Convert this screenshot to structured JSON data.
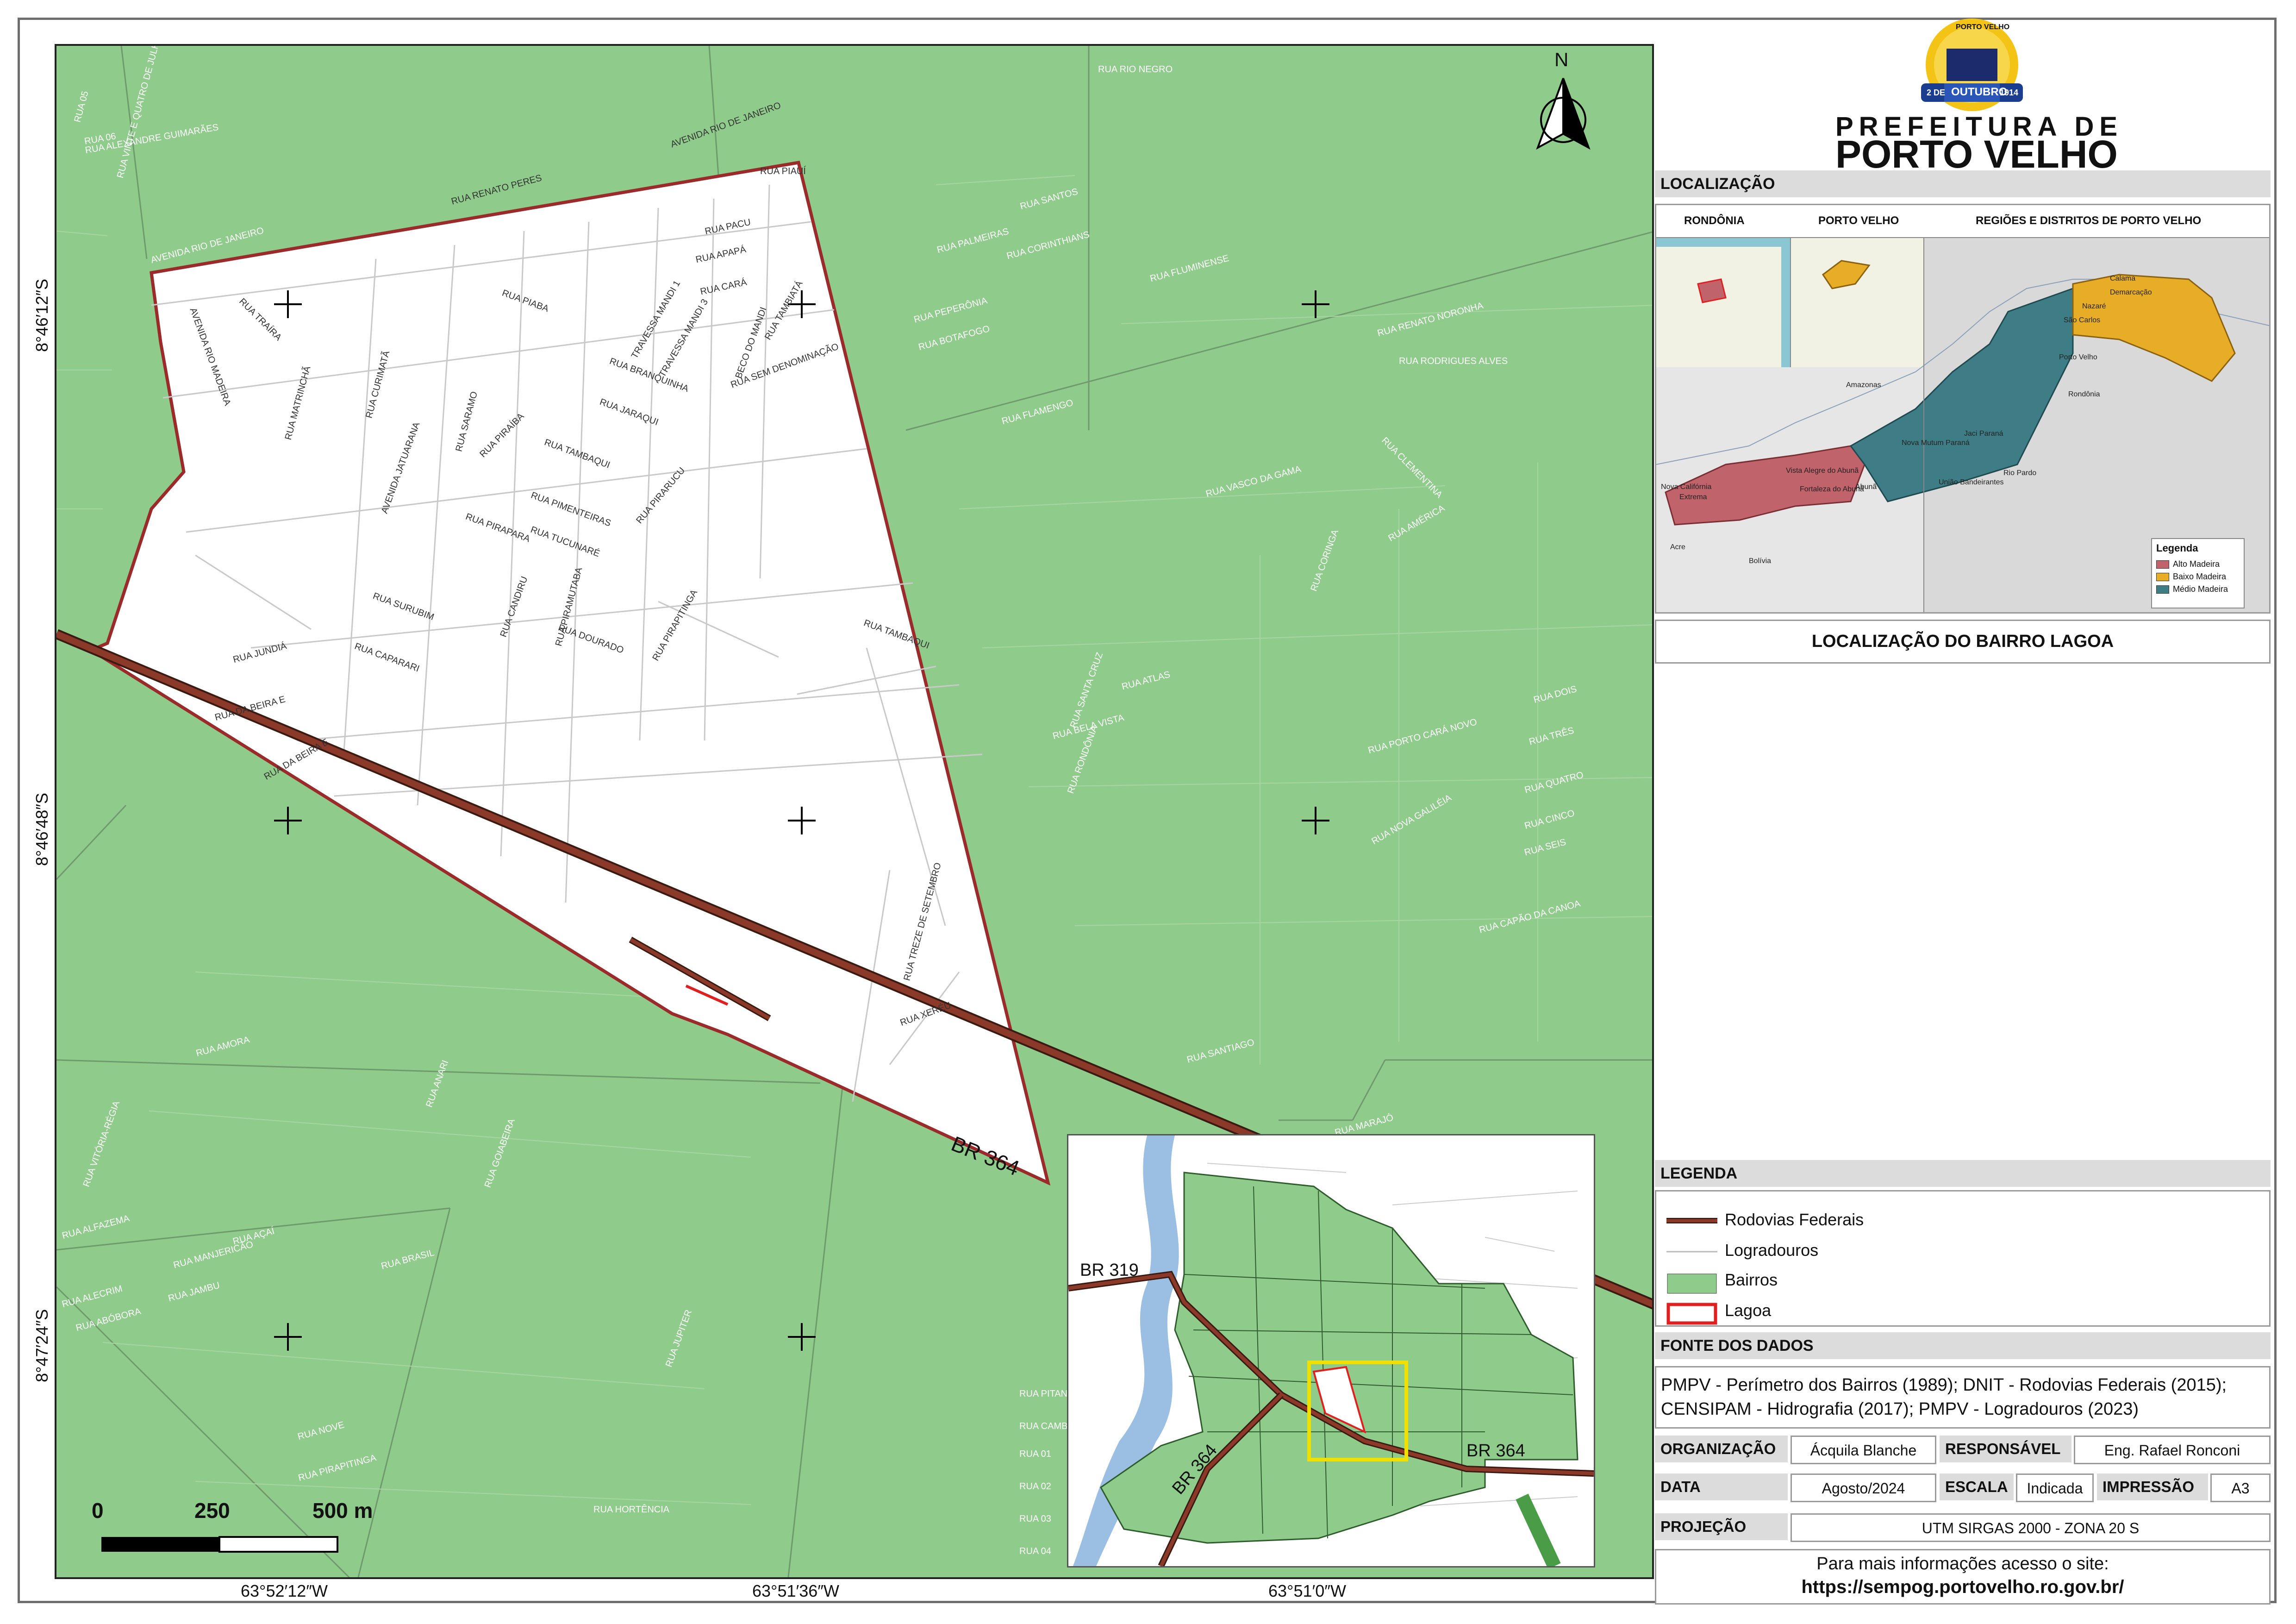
{
  "map": {
    "north_label": "N",
    "lat_labels": [
      "8°46′12″S",
      "8°46′48″S",
      "8°47′24″S"
    ],
    "lon_labels": [
      "63°52′12″W",
      "63°51′36″W",
      "63°51′0″W"
    ],
    "scale_labels": [
      "0",
      "250",
      "500 m"
    ],
    "highway_label": "BR 364",
    "street_labels_inside": [
      "RUA PIAUÍ",
      "RUA PACU",
      "RUA APAPÁ",
      "RUA CARÁ",
      "RUA PIABA",
      "RUA TAMBIATÁ",
      "TRAVESSA MANDI 1",
      "TRAVESSA MANDI 3",
      "BECO DO MANDI",
      "RUA SEM DENOMINAÇÃO",
      "RUA BRANQUINHA",
      "RUA JARAQUI",
      "RUA TAMBAQUI",
      "RUA PIMENTEIRAS",
      "RUA TUCUNARÉ",
      "RUA PIRARUCU",
      "RUA MATRINCHÃ",
      "RUA CURIMATÃ",
      "RUA SARAMO",
      "RUA PIRAÍBA",
      "RUA PIRAPARA",
      "RUA CANDIRU",
      "RUA PIRAMUTABA",
      "RUA DOURADO",
      "RUA PIRAPITINGA",
      "RUA SURUBIM",
      "RUA CAPARARI",
      "RUA JUNDIÁ",
      "RUA DA BEIRA E",
      "RUA TAMBAQUI",
      "RUA TREZE DE SETEMBRO",
      "RUA XERÉU",
      "RUA TRAÍRA",
      "AVENIDA RIO MADEIRA",
      "AVENIDA JATUARANA",
      "AVENIDA RIO DE JANEIRO",
      "RUA RENATO PERES",
      "RUA DA BEIRA E"
    ],
    "street_labels_outside": [
      "RUA VINTE E QUATRO DE JULHO",
      "RUA ALEXANDRE GUIMARÃES",
      "AVENIDA RIO DE JANEIRO",
      "RUA RIO NEGRO",
      "RUA SANTOS",
      "RUA PALMEIRAS",
      "RUA CORINTHIANS",
      "RUA FLUMINENSE",
      "RUA BOTAFOGO",
      "RUA PEPERÔNIA",
      "RUA FLAMENGO",
      "RUA RODRIGUES ALVES",
      "RUA RENATO NORONHA",
      "RUA CLEMENTINA",
      "RUA AMÉRICA",
      "RUA CORINGA",
      "RUA VASCO DA GAMA",
      "RUA SANTA CRUZ",
      "RUA BELA VISTA",
      "RUA RONDÔNIA",
      "RUA ATLAS",
      "RUA PORTO CARÁ NOVO",
      "RUA NOVA GALILÉIA",
      "RUA SEIS",
      "RUA CINCO",
      "RUA QUATRO",
      "RUA TRÊS",
      "RUA DOIS",
      "RUA CAPÃO DA CANOA",
      "RUA SANTIAGO",
      "RUA MARAJÓ",
      "RUA ALFAZEMA",
      "RUA ALECRIM",
      "RUA ABÓBORA",
      "RUA JAMBU",
      "RUA MANJERICÃO",
      "RUA AÇAÍ",
      "RUA AMORA",
      "RUA VITÓRIA-RÉGIA",
      "RUA HORTÊNCIA",
      "RUA BRASIL",
      "RUA ANARI",
      "RUA JUPITER",
      "RUA NOVE",
      "RUA PIRAPITINGA",
      "RUA GOIABEIRA",
      "RUA PITANGUEIRA",
      "RUA CAMBARÁ",
      "RUA 01",
      "RUA 02",
      "RUA 03",
      "RUA 04",
      "RUA 05",
      "RUA 06"
    ]
  },
  "header": {
    "logo_top": "PORTO VELHO",
    "logo_ribbon": "OUTUBRO",
    "logo_bottom_left": "2 DE",
    "logo_bottom_right": "1914",
    "brand_line1": "PREFEITURA DE",
    "brand_line2": "PORTO VELHO"
  },
  "localizacao": {
    "heading": "LOCALIZAÇÃO",
    "col1": "RONDÔNIA",
    "col2": "PORTO VELHO",
    "col3": "REGIÕES E DISTRITOS DE PORTO VELHO",
    "place_labels": [
      "Amazonas",
      "Acre",
      "Bolívia",
      "Rondônia",
      "Nova Califórnia",
      "Extrema",
      "Vista Alegre do Abunã",
      "Fortaleza do Abunã",
      "Abunã",
      "Nova Mutum Paraná",
      "Jaci Paraná",
      "União Bandeirantes",
      "Rio Pardo",
      "Porto Velho",
      "Calama",
      "Demarcação",
      "Nazaré",
      "São Carlos"
    ],
    "inner_legend_title": "Legenda",
    "inner_legend": [
      {
        "label": "Alto Madeira",
        "color": "#c0636a"
      },
      {
        "label": "Baixo Madeira",
        "color": "#e8ad26"
      },
      {
        "label": "Médio Madeira",
        "color": "#3f7d86"
      }
    ],
    "caption": "LOCALIZAÇÃO DO BAIRRO LAGOA"
  },
  "inset": {
    "labels": [
      "BR 319",
      "BR 364",
      "BR 364"
    ]
  },
  "legenda": {
    "heading": "LEGENDA",
    "items": [
      {
        "label": "Rodovias Federais",
        "color": "#8b3a2a"
      },
      {
        "label": "Logradouros",
        "color": "#d7d7d7"
      },
      {
        "label": "Bairros",
        "color": "#8fcb8b"
      },
      {
        "label": "Lagoa",
        "color": "#e02020"
      }
    ]
  },
  "fonte": {
    "heading": "FONTE DOS DADOS",
    "text": "PMPV - Perímetro dos Bairros (1989); DNIT - Rodovias Federais (2015); CENSIPAM - Hidrografia (2017); PMPV - Logradouros (2023)"
  },
  "meta": {
    "organizacao_label": "ORGANIZAÇÃO",
    "organizacao": "Ácquila Blanche",
    "responsavel_label": "RESPONSÁVEL",
    "responsavel": "Eng. Rafael Ronconi",
    "data_label": "DATA",
    "data": "Agosto/2024",
    "escala_label": "ESCALA",
    "escala": "Indicada",
    "impressao_label": "IMPRESSÃO",
    "impressao": "A3",
    "projecao_label": "PROJEÇÃO",
    "projecao": "UTM SIRGAS 2000 - ZONA 20 S"
  },
  "footer": {
    "line1": "Para mais informações acesso o site:",
    "line2": "https://sempog.portovelho.ro.gov.br/"
  }
}
